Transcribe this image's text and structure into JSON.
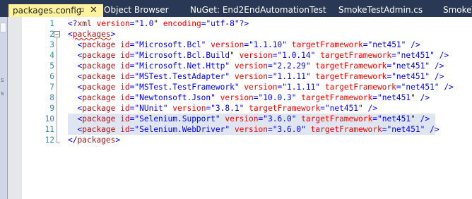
{
  "tabs": [
    {
      "label": "packages.config",
      "active": true,
      "pin": "⊐",
      "close": "✕"
    },
    {
      "label": "Object Browser"
    },
    {
      "label": "NuGet: End2EndAutomationTest"
    },
    {
      "label": "SmokeTestAdmin.cs"
    },
    {
      "label": "SmokeTe"
    }
  ],
  "colors": {
    "tab_strip": "#293955",
    "active_tab": "#fff29d",
    "line_number": "#2b91af",
    "xml_bracket": "#0000ff",
    "xml_element": "#a31515",
    "xml_attribute": "#ff0000",
    "xml_value": "#0000ff",
    "selection": "#dfe6f1"
  },
  "left_panel_glyphs": [
    "s",
    "s"
  ],
  "editor": {
    "fold_marker": "−",
    "lines": [
      {
        "num": "1",
        "declaration": {
          "open": "<?",
          "name": "xml",
          "attrs": [
            {
              "name": "version",
              "value": "\"1.0\""
            },
            {
              "name": "encoding",
              "value": "\"utf-8\""
            }
          ],
          "close": "?>"
        }
      },
      {
        "num": "2",
        "open_tag": "packages"
      },
      {
        "num": "3",
        "package": {
          "id": "\"Microsoft.Bcl\"",
          "version": "\"1.1.10\"",
          "targetFramework": "\"net451\""
        }
      },
      {
        "num": "4",
        "package": {
          "id": "\"Microsoft.Bcl.Build\"",
          "version": "\"1.0.14\"",
          "targetFramework": "\"net451\""
        }
      },
      {
        "num": "5",
        "package": {
          "id": "\"Microsoft.Net.Http\"",
          "version": "\"2.2.29\"",
          "targetFramework": "\"net451\""
        }
      },
      {
        "num": "6",
        "package": {
          "id": "\"MSTest.TestAdapter\"",
          "version": "\"1.1.11\"",
          "targetFramework": "\"net451\""
        }
      },
      {
        "num": "7",
        "package": {
          "id": "\"MSTest.TestFramework\"",
          "version": "\"1.1.11\"",
          "targetFramework": "\"net451\""
        }
      },
      {
        "num": "8",
        "package": {
          "id": "\"Newtonsoft.Json\"",
          "version": "\"10.0.3\"",
          "targetFramework": "\"net451\""
        }
      },
      {
        "num": "9",
        "package": {
          "id": "\"NUnit\"",
          "version": "\"3.8.1\"",
          "targetFramework": "\"net451\""
        }
      },
      {
        "num": "10",
        "selected": true,
        "package": {
          "id": "\"Selenium.Support\"",
          "version": "\"3.6.0\"",
          "targetFramework": "\"net451\""
        }
      },
      {
        "num": "11",
        "selected": true,
        "package": {
          "id": "\"Selenium.WebDriver\"",
          "version": "\"3.6.0\"",
          "targetFramework": "\"net451\""
        }
      },
      {
        "num": "12",
        "close_tag": "packages"
      }
    ]
  }
}
